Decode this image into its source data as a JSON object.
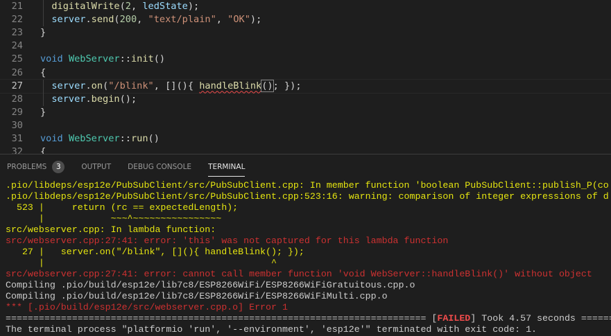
{
  "editor": {
    "current_line": 27,
    "lines": [
      {
        "n": "21",
        "tokens": [
          [
            "p",
            "  "
          ],
          [
            "fn",
            "digitalWrite"
          ],
          [
            "p",
            "("
          ],
          [
            "num",
            "2"
          ],
          [
            "p",
            ", "
          ],
          [
            "var",
            "ledState"
          ],
          [
            "p",
            ");"
          ]
        ]
      },
      {
        "n": "22",
        "tokens": [
          [
            "p",
            "  "
          ],
          [
            "var",
            "server"
          ],
          [
            "p",
            "."
          ],
          [
            "fn",
            "send"
          ],
          [
            "p",
            "("
          ],
          [
            "num",
            "200"
          ],
          [
            "p",
            ", "
          ],
          [
            "str",
            "\"text/plain\""
          ],
          [
            "p",
            ", "
          ],
          [
            "str",
            "\"OK\""
          ],
          [
            "p",
            ");"
          ]
        ]
      },
      {
        "n": "23",
        "tokens": [
          [
            "p",
            "}"
          ]
        ]
      },
      {
        "n": "24",
        "tokens": []
      },
      {
        "n": "25",
        "tokens": [
          [
            "kw",
            "void"
          ],
          [
            "p",
            " "
          ],
          [
            "type",
            "WebServer"
          ],
          [
            "p",
            "::"
          ],
          [
            "fn",
            "init"
          ],
          [
            "p",
            "()"
          ]
        ]
      },
      {
        "n": "26",
        "tokens": [
          [
            "p",
            "{"
          ]
        ]
      },
      {
        "n": "27",
        "tokens": [
          [
            "p",
            "  "
          ],
          [
            "var",
            "server"
          ],
          [
            "p",
            "."
          ],
          [
            "fn",
            "on"
          ],
          [
            "p",
            "("
          ],
          [
            "str",
            "\"/blink\""
          ],
          [
            "p",
            ", [](){ "
          ],
          [
            "fn squig",
            "handleBlink"
          ],
          [
            "p bracket",
            "()"
          ],
          [
            "p",
            "; });"
          ]
        ]
      },
      {
        "n": "28",
        "tokens": [
          [
            "p",
            "  "
          ],
          [
            "var",
            "server"
          ],
          [
            "p",
            "."
          ],
          [
            "fn",
            "begin"
          ],
          [
            "p",
            "();"
          ]
        ]
      },
      {
        "n": "29",
        "tokens": [
          [
            "p",
            "}"
          ]
        ]
      },
      {
        "n": "30",
        "tokens": []
      },
      {
        "n": "31",
        "tokens": [
          [
            "kw",
            "void"
          ],
          [
            "p",
            " "
          ],
          [
            "type",
            "WebServer"
          ],
          [
            "p",
            "::"
          ],
          [
            "fn",
            "run"
          ],
          [
            "p",
            "()"
          ]
        ]
      },
      {
        "n": "32",
        "tokens": [
          [
            "p",
            "{"
          ]
        ]
      }
    ]
  },
  "panel": {
    "tabs": [
      {
        "label": "PROBLEMS",
        "badge": "3",
        "active": false
      },
      {
        "label": "OUTPUT",
        "active": false
      },
      {
        "label": "DEBUG CONSOLE",
        "active": false
      },
      {
        "label": "TERMINAL",
        "active": true
      }
    ],
    "terminal": [
      [
        [
          "y",
          ".pio/libdeps/esp12e/PubSubClient/src/PubSubClient.cpp: In member function 'boolean PubSubClient::publish_P(co"
        ]
      ],
      [
        [
          "y",
          ".pio/libdeps/esp12e/PubSubClient/src/PubSubClient.cpp:523:16: warning: comparison of integer expressions of d"
        ]
      ],
      [
        [
          "y",
          "  523 |     return (rc == expectedLength);"
        ]
      ],
      [
        [
          "y",
          "      |            ~~~^~~~~~~~~~~~~~~~~"
        ]
      ],
      [
        [
          "y",
          "src/webserver.cpp: In lambda function:"
        ]
      ],
      [
        [
          "r",
          "src/webserver.cpp:27:41: error: 'this' was not captured for this lambda function"
        ]
      ],
      [
        [
          "y",
          "   27 |   server.on(\"/blink\", [](){ handleBlink(); });"
        ]
      ],
      [
        [
          "y",
          "      |                                         ^"
        ]
      ],
      [
        [
          "r",
          "src/webserver.cpp:27:41: error: cannot call member function 'void WebServer::handleBlink()' without object"
        ]
      ],
      [
        [
          "w",
          "Compiling .pio/build/esp12e/lib7c8/ESP8266WiFi/ESP8266WiFiGratuitous.cpp.o"
        ]
      ],
      [
        [
          "w",
          "Compiling .pio/build/esp12e/lib7c8/ESP8266WiFi/ESP8266WiFiMulti.cpp.o"
        ]
      ],
      [
        [
          "r",
          "*** [.pio/build/esp12e/src/webserver.cpp.o] Error 1"
        ]
      ],
      [
        [
          "w",
          "============================================================================ ["
        ],
        [
          "fail",
          "FAILED"
        ],
        [
          "w",
          "] Took 4.57 seconds ========="
        ]
      ],
      [
        [
          "w",
          "The terminal process \"platformio 'run', '--environment', 'esp12e'\" terminated with exit code: 1."
        ]
      ]
    ]
  }
}
